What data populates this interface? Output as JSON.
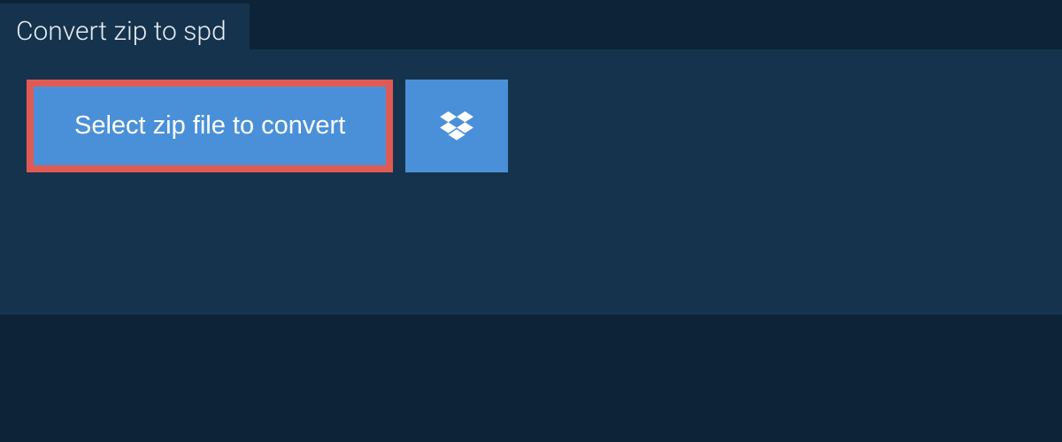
{
  "tab": {
    "title": "Convert zip to spd"
  },
  "actions": {
    "select_file_label": "Select zip file to convert"
  }
}
